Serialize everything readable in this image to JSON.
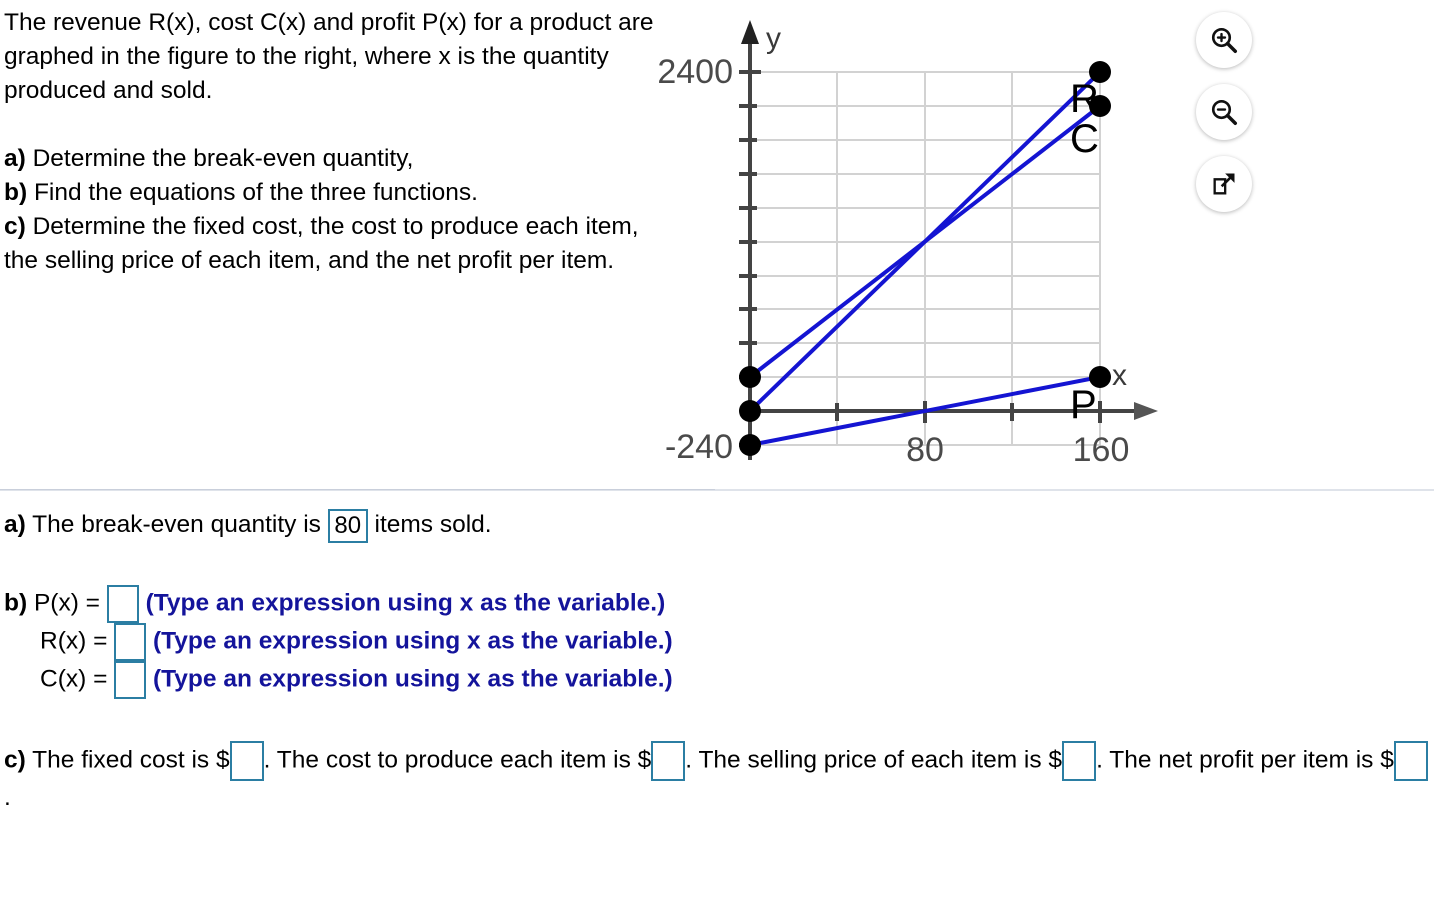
{
  "problem": {
    "intro": "The revenue R(x), cost C(x) and profit P(x) for a product are graphed in the figure to the right, where x is the quantity produced and sold.",
    "parts": [
      {
        "label": "a)",
        "text": "Determine the break-even quantity,"
      },
      {
        "label": "b)",
        "text": "Find the equations of the three functions."
      },
      {
        "label": "c)",
        "text": "Determine the fixed cost, the cost to produce each item, the selling price of each item, and the net profit per item."
      }
    ]
  },
  "icons": [
    {
      "name": "zoom-in-icon",
      "title": "Zoom in"
    },
    {
      "name": "zoom-out-icon",
      "title": "Zoom out"
    },
    {
      "name": "open-in-new-window-icon",
      "title": "Open in new window"
    }
  ],
  "chart_data": {
    "type": "line",
    "title": "",
    "xlabel": "x",
    "ylabel": "y",
    "xlim": [
      0,
      180
    ],
    "ylim": [
      -240,
      2520
    ],
    "xticks": [
      0,
      40,
      80,
      120,
      160
    ],
    "xtick_labels": [
      "",
      "",
      "80",
      "",
      "160"
    ],
    "yticks": [
      -240,
      0,
      240,
      480,
      720,
      960,
      1200,
      1440,
      1680,
      1920,
      2160,
      2400
    ],
    "ytick_labels": [
      "-240",
      "",
      "",
      "",
      "",
      "",
      "",
      "",
      "",
      "",
      "",
      "2400"
    ],
    "grid": true,
    "axis_color": "#444444",
    "grid_color": "#d2d2d2",
    "series_color": "#1414d2",
    "series": [
      {
        "name": "R",
        "label": "R",
        "points": [
          [
            0,
            0
          ],
          [
            160,
            2400
          ]
        ],
        "endpoint_markers": [
          [
            0,
            0
          ],
          [
            160,
            2400
          ]
        ]
      },
      {
        "name": "C",
        "label": "C",
        "points": [
          [
            0,
            240
          ],
          [
            160,
            2160
          ]
        ],
        "endpoint_markers": [
          [
            0,
            240
          ],
          [
            160,
            2160
          ]
        ]
      },
      {
        "name": "P",
        "label": "P",
        "points": [
          [
            0,
            -240
          ],
          [
            160,
            240
          ]
        ],
        "endpoint_markers": [
          [
            0,
            -240
          ],
          [
            160,
            240
          ]
        ]
      }
    ]
  },
  "answers": {
    "a": {
      "label": "a)",
      "before": "The break-even quantity is",
      "value": "80",
      "after": "items sold."
    },
    "b": {
      "label": "b)",
      "hint": "(Type an expression using x as the variable.)",
      "rows": [
        {
          "name": "P(x) =",
          "value": ""
        },
        {
          "name": "R(x) =",
          "value": ""
        },
        {
          "name": "C(x) =",
          "value": ""
        }
      ]
    },
    "c": {
      "label": "c)",
      "seg1": "The fixed cost is $",
      "seg2": ". The cost to produce each item is $",
      "seg3": ". The selling price of each item is $",
      "seg4": ". The net profit per item is $",
      "seg5": ".",
      "values": [
        "",
        "",
        "",
        ""
      ]
    }
  }
}
